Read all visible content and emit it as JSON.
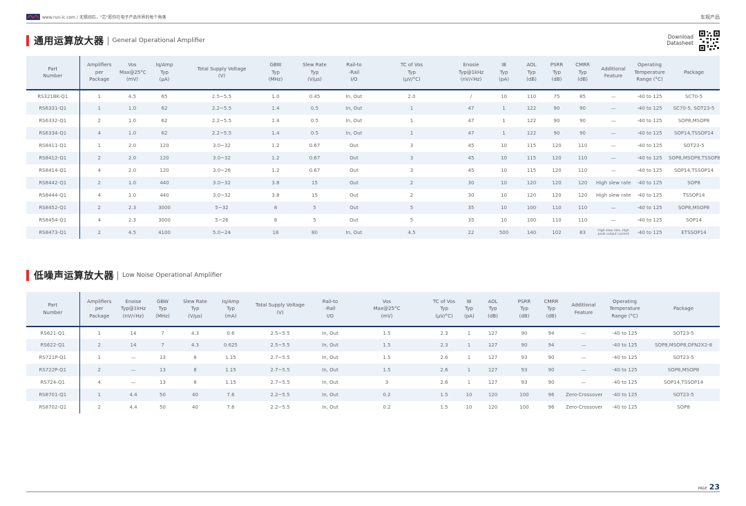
{
  "header": {
    "url_text": "www.run-ic.com / 无锡润石，\"芯\"愿你在电子产品世界的每个角落",
    "category": "车规产品"
  },
  "download": {
    "line1": "Download",
    "line2": "Datasheet"
  },
  "section1": {
    "title_cn": "通用运算放大器",
    "title_en": "General Operational Amplifier",
    "columns": [
      [
        "Part",
        "Number"
      ],
      [
        "Amplifiers",
        "per",
        "Package"
      ],
      [
        "Vos",
        "Max@25°C",
        "(mV)"
      ],
      [
        "Iq/Amp",
        "Typ",
        "(μA)"
      ],
      [
        "Total Supply Voltage",
        "(V)"
      ],
      [
        "GBW",
        "Typ",
        "(MHz)"
      ],
      [
        "Slew Rate",
        "Typ",
        "(V/μs)"
      ],
      [
        "Rail-to",
        "-Rail",
        "I/O"
      ],
      [
        "TC of Vos",
        "Typ",
        "(μV/°C)"
      ],
      [
        "Enosie",
        "Typ@1kHz",
        "(nV/√Hz)"
      ],
      [
        "IB",
        "Typ",
        "(pA)"
      ],
      [
        "AOL",
        "Typ",
        "(dB)"
      ],
      [
        "PSRR",
        "Typ",
        "(dB)"
      ],
      [
        "CMRR",
        "Typ",
        "(dB)"
      ],
      [
        "Additional",
        "Feature"
      ],
      [
        "Operating",
        "Temperature",
        "Range (°C)"
      ],
      [
        "Package"
      ]
    ],
    "rows": [
      [
        "RS321BK-Q1",
        "1",
        "4.5",
        "65",
        "2.5~5.5",
        "1.0",
        "0.45",
        "In, Out",
        "2.0",
        "/",
        "10",
        "110",
        "75",
        "85",
        "—",
        "-40 to 125",
        "SC70-5"
      ],
      [
        "RS6331-Q1",
        "1",
        "1.0",
        "62",
        "2.2~5.5",
        "1.4",
        "0.5",
        "In, Out",
        "1",
        "47",
        "1",
        "122",
        "90",
        "90",
        "—",
        "-40 to 125",
        "SC70-5, SOT23-5"
      ],
      [
        "RS6332-Q1",
        "2",
        "1.0",
        "62",
        "2.2~5.5",
        "1.4",
        "0.5",
        "In, Out",
        "1",
        "47",
        "1",
        "122",
        "90",
        "90",
        "—",
        "-40 to 125",
        "SOP8,MSOP8"
      ],
      [
        "RS6334-Q1",
        "4",
        "1.0",
        "62",
        "2.2~5.5",
        "1.4",
        "0.5",
        "In, Out",
        "1",
        "47",
        "1",
        "122",
        "90",
        "90",
        "—",
        "-40 to 125",
        "SOP14,TSSOP14"
      ],
      [
        "RS8411-Q1",
        "1",
        "2.0",
        "120",
        "3.0~32",
        "1.2",
        "0.67",
        "Out",
        "3",
        "45",
        "10",
        "115",
        "120",
        "110",
        "—",
        "-40 to 125",
        "SOT23-5"
      ],
      [
        "RS8412-Q1",
        "2",
        "2.0",
        "120",
        "3.0~32",
        "1.2",
        "0.67",
        "Out",
        "3",
        "45",
        "10",
        "115",
        "120",
        "110",
        "—",
        "-40 to 125",
        "SOP8,MSOP8,TSSOP8"
      ],
      [
        "RS8414-Q1",
        "4",
        "2.0",
        "120",
        "3.0~26",
        "1.2",
        "0.67",
        "Out",
        "3",
        "45",
        "10",
        "115",
        "120",
        "110",
        "—",
        "-40 to 125",
        "SOP14,TSSOP14"
      ],
      [
        "RS8442-Q1",
        "2",
        "1.0",
        "440",
        "3.0~32",
        "3.8",
        "15",
        "Out",
        "2",
        "30",
        "10",
        "120",
        "120",
        "120",
        "High slew rate",
        "-40 to 125",
        "SOP8"
      ],
      [
        "RS8444-Q1",
        "4",
        "1.0",
        "440",
        "3.0~32",
        "3.8",
        "15",
        "Out",
        "2",
        "30",
        "10",
        "120",
        "120",
        "120",
        "High slew rate",
        "-40 to 125",
        "TSSOP14"
      ],
      [
        "RS8452-Q1",
        "2",
        "2.3",
        "3000",
        "5~32",
        "8",
        "5",
        "Out",
        "5",
        "35",
        "10",
        "100",
        "110",
        "110",
        "—",
        "-40 to 125",
        "SOP8,MSOP8"
      ],
      [
        "RS8454-Q1",
        "4",
        "2.3",
        "3000",
        "5~26",
        "8",
        "5",
        "Out",
        "5",
        "35",
        "10",
        "100",
        "110",
        "110",
        "—",
        "-40 to 125",
        "SOP14"
      ],
      [
        "RS8473-Q1",
        "2",
        "4.5",
        "4100",
        "5.0~24",
        "18",
        "80",
        "In, Out",
        "4.5",
        "22",
        "500",
        "140",
        "102",
        "83",
        "High slew rate, High peak output current",
        "-40 to 125",
        "ETSSOP14"
      ]
    ]
  },
  "section2": {
    "title_cn": "低噪声运算放大器",
    "title_en": "Low Noise Operational Amplifier",
    "columns": [
      [
        "Part",
        "Number"
      ],
      [
        "Amplifiers",
        "per",
        "Package"
      ],
      [
        "Enoise",
        "Typ@1kHz",
        "(nV/√Hz)"
      ],
      [
        "GBW",
        "Typ",
        "(MHz)"
      ],
      [
        "Slew Rate",
        "Typ",
        "(V/μs)"
      ],
      [
        "Iq/Amp",
        "Typ",
        "(mA)"
      ],
      [
        "Total Supply Voltage",
        "(V)"
      ],
      [
        "Rail-to",
        "-Rail",
        "I/O"
      ],
      [
        "Vos",
        "Max@25°C",
        "(mV)"
      ],
      [
        "TC of Vos",
        "Typ",
        "(μV/°C)"
      ],
      [
        "IB",
        "Typ",
        "(pA)"
      ],
      [
        "AOL",
        "Typ",
        "(dB)"
      ],
      [
        "PSRR",
        "Typ",
        "(dB)"
      ],
      [
        "CMRR",
        "Typ",
        "(dB)"
      ],
      [
        "Additional",
        "Feature"
      ],
      [
        "Operating",
        "Temperature",
        "Range (°C)"
      ],
      [
        "Package"
      ]
    ],
    "rows": [
      [
        "RS621-Q1",
        "1",
        "14",
        "7",
        "4.3",
        "0.6",
        "2.5~5.5",
        "In, Out",
        "1.5",
        "2.3",
        "1",
        "127",
        "90",
        "94",
        "—",
        "-40 to 125",
        "SOT23-5"
      ],
      [
        "RS622-Q1",
        "2",
        "14",
        "7",
        "4.3",
        "0.625",
        "2.5~5.5",
        "In, Out",
        "1.5",
        "2.3",
        "1",
        "127",
        "90",
        "94",
        "—",
        "-40 to 125",
        "SOP8,MSOP8,DFN2X2-8"
      ],
      [
        "RS721P-Q1",
        "1",
        "—",
        "13",
        "8",
        "1.15",
        "2.7~5.5",
        "In, Out",
        "1.5",
        "2.6",
        "1",
        "127",
        "93",
        "90",
        "—",
        "-40 to 125",
        "SOT23-5"
      ],
      [
        "RS722P-Q1",
        "2",
        "—",
        "13",
        "8",
        "1.15",
        "2.7~5.5",
        "In, Out",
        "1.5",
        "2.6",
        "1",
        "127",
        "93",
        "90",
        "—",
        "-40 to 125",
        "SOP8,MSOP8"
      ],
      [
        "RS724-Q1",
        "4",
        "—",
        "13",
        "8",
        "1.15",
        "2.7~5.5",
        "In, Out",
        "3",
        "2.6",
        "1",
        "127",
        "93",
        "90",
        "—",
        "-40 to 125",
        "SOP14,TSSOP14"
      ],
      [
        "RS8701-Q1",
        "1",
        "4.4",
        "50",
        "40",
        "7.6",
        "2.2~5.5",
        "In, Out",
        "0.2",
        "1.5",
        "10",
        "120",
        "100",
        "96",
        "Zero-Crossover",
        "-40 to 125",
        "SOT23-5"
      ],
      [
        "RS8702-Q1",
        "2",
        "4.4",
        "50",
        "40",
        "7.6",
        "2.2~5.5",
        "In, Out",
        "0.2",
        "1.5",
        "10",
        "120",
        "100",
        "96",
        "Zero-Crossover",
        "-40 to 125",
        "SOP8"
      ]
    ]
  },
  "footer": {
    "page_label": "PAGE",
    "page_number": "23"
  },
  "colors": {
    "accent_red": "#e32d2d",
    "navy": "#1f3a6e",
    "header_bg": "#e8eef6",
    "row_alt": "#edf2f8"
  }
}
